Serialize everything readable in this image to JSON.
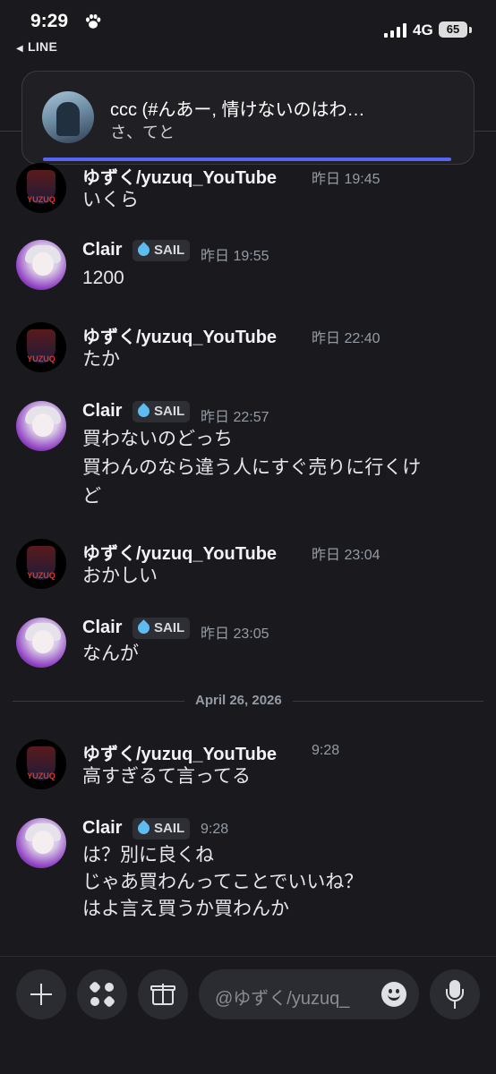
{
  "status_bar": {
    "time": "9:29",
    "back_app": "LINE",
    "network": "4G",
    "battery": "65"
  },
  "notification": {
    "title": "ccc (#んあー, 情けないのはわ…",
    "body": "さ、てと"
  },
  "messages": [
    {
      "author": "ゆずく/yuzuq_YouTube",
      "tag": "",
      "time": "昨日 19:45",
      "lines": [
        "いくら"
      ]
    },
    {
      "author": "Clair",
      "tag": "SAIL",
      "time": "昨日 19:55",
      "lines": [
        "1200"
      ]
    },
    {
      "author": "ゆずく/yuzuq_YouTube",
      "tag": "",
      "time": "昨日 22:40",
      "lines": [
        "たか"
      ]
    },
    {
      "author": "Clair",
      "tag": "SAIL",
      "time": "昨日 22:57",
      "lines": [
        "買わないのどっち",
        "買わんのなら違う人にすぐ売りに行くけ",
        "ど"
      ]
    },
    {
      "author": "ゆずく/yuzuq_YouTube",
      "tag": "",
      "time": "昨日 23:04",
      "lines": [
        "おかしい"
      ]
    },
    {
      "author": "Clair",
      "tag": "SAIL",
      "time": "昨日 23:05",
      "lines": [
        "なんが"
      ]
    },
    {
      "author": "ゆずく/yuzuq_YouTube",
      "tag": "",
      "time": "9:28",
      "lines": [
        "高すぎるて言ってる"
      ]
    },
    {
      "author": "Clair",
      "tag": "SAIL",
      "time": "9:28",
      "lines": [
        "は？別に良くね",
        "じゃあ買わんってことでいいね？",
        "はよ言え買うか買わんか"
      ]
    }
  ],
  "date_divider": "April 26, 2026",
  "composer": {
    "placeholder": "@ゆずく/yuzuq_"
  },
  "yuzuq_avatar_label": "YUZUQ"
}
